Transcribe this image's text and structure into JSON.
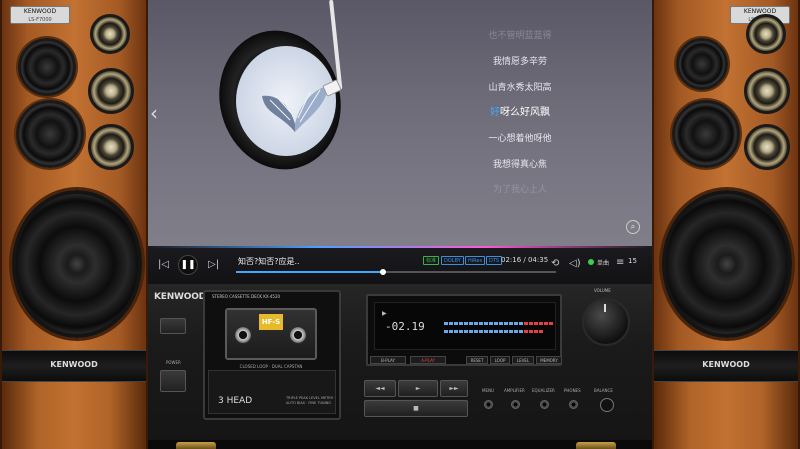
{
  "speakers": {
    "badge_title": "KENWOOD",
    "badge_model": "LS-F7000",
    "brand": "KENWOOD"
  },
  "player": {
    "lyrics": [
      {
        "text": "也不管明蓝蓝得",
        "state": "faded"
      },
      {
        "text": "我情愿多辛劳",
        "state": "normal"
      },
      {
        "text": "山青水秀太阳高",
        "state": "normal"
      },
      {
        "text_highlight": "好",
        "text_rest": "呀么好风飘",
        "state": "active"
      },
      {
        "text": "一心想着他呀他",
        "state": "normal"
      },
      {
        "text": "我想得真心焦",
        "state": "normal"
      },
      {
        "text": "为了我心上人",
        "state": "faded"
      }
    ],
    "lyrics_search_icon": "search-lyrics-icon",
    "song_title": "知否?知否?应是..",
    "badges": [
      "标准",
      "DOLBY",
      "HiRes",
      "DTS"
    ],
    "time_current": "02:16",
    "time_total": "04:35",
    "time_display": "02:16 / 04:35",
    "progress": 0.46,
    "accent_color": "#3fa9ff",
    "like_label": "单曲",
    "playlist_count": "15"
  },
  "deck": {
    "brand": "KENWOOD",
    "power_label": "POWER",
    "cassette_header": "STEREO CASSETTE DECK KX-4520",
    "tape_brand": "HF-S",
    "tape_caption": "CLOSED LOOP · DUAL CAPSTAN",
    "head_label": "3 HEAD",
    "head_fine": "TRIPLE PEAK LEVEL METER · AUTO BIAS · FINE TUNING",
    "counter": "-02.19",
    "display_buttons": [
      "B-PLAY",
      "A-PLAY",
      "RESET",
      "LOOP",
      "LEVEL",
      "MEMORY"
    ],
    "transport": {
      "rew": "◄◄",
      "play": "►",
      "ff": "►►",
      "stop": "■"
    },
    "volume_label": "VOLUME",
    "jack_labels": [
      "MENU",
      "AMPLIFIER",
      "EQUALIZER",
      "PHONES",
      "BALANCE"
    ]
  }
}
